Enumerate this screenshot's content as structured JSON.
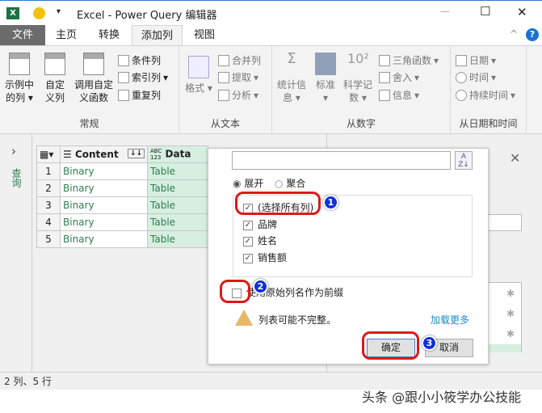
{
  "window": {
    "title": "Excel - Power Query 编辑器",
    "minimize": "—",
    "maximize": "☐",
    "close": "✕"
  },
  "tabs": [
    {
      "label": "文件"
    },
    {
      "label": "主页"
    },
    {
      "label": "转换"
    },
    {
      "label": "添加列"
    },
    {
      "label": "视图"
    }
  ],
  "ribbon": {
    "general": {
      "label": "常规",
      "example": "示例中的列",
      "custom": "自定义列",
      "invoke": "调用自定义函数",
      "conditional": "条件列",
      "index": "索引列",
      "duplicate": "重复列"
    },
    "text": {
      "label": "从文本",
      "format": "格式",
      "merge": "合并列",
      "extract": "提取",
      "parse": "分析"
    },
    "number": {
      "label": "从数字",
      "stats": "统计信息",
      "standard": "标准",
      "scientific": "科学记数",
      "trig": "三角函数",
      "round": "舍入",
      "info": "信息"
    },
    "datetime": {
      "label": "从日期和时间",
      "date": "日期",
      "time": "时间",
      "duration": "持续时间"
    }
  },
  "queries_label": "查询",
  "table": {
    "headers": [
      "Content",
      "Data"
    ],
    "type_label": "ABC\n123",
    "rows": [
      [
        "1",
        "Binary",
        "Table"
      ],
      [
        "2",
        "Binary",
        "Table"
      ],
      [
        "3",
        "Binary",
        "Table"
      ],
      [
        "4",
        "Binary",
        "Table"
      ],
      [
        "5",
        "Binary",
        "Table"
      ]
    ]
  },
  "dialog": {
    "search_value": "",
    "expand": "展开",
    "aggregate": "聚合",
    "columns": [
      "(选择所有列)",
      "品牌",
      "姓名",
      "销售额"
    ],
    "prefix": "使用原始列名作为前缀",
    "warning": "列表可能不完整。",
    "load_more": "加载更多",
    "ok": "确定",
    "cancel": "取消"
  },
  "annotations": [
    "1",
    "2",
    "3"
  ],
  "status": "2 列、5 行",
  "watermark": "头条 @跟小小筱学办公技能"
}
